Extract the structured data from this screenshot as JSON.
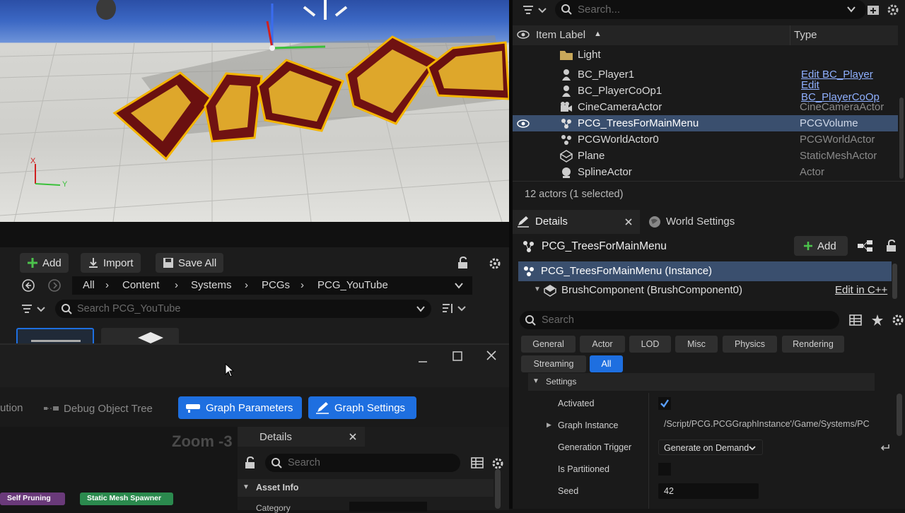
{
  "viewport": {
    "axis_x_label": "X",
    "axis_y_label": "Y"
  },
  "outliner": {
    "search_placeholder": "Search...",
    "col_label": "Item Label",
    "col_type": "Type",
    "rows": [
      {
        "label": "Light",
        "type": ""
      },
      {
        "label": "BC_Player1",
        "type": "Edit BC_Player"
      },
      {
        "label": "BC_PlayerCoOp1",
        "type": "Edit BC_PlayerCoOp"
      },
      {
        "label": "CineCameraActor",
        "type": "CineCameraActor"
      },
      {
        "label": "PCG_TreesForMainMenu",
        "type": "PCGVolume"
      },
      {
        "label": "PCGWorldActor0",
        "type": "PCGWorldActor"
      },
      {
        "label": "Plane",
        "type": "StaticMeshActor"
      },
      {
        "label": "SplineActor",
        "type": "Actor"
      }
    ],
    "status": "12 actors (1 selected)"
  },
  "content_browser": {
    "add": "Add",
    "import": "Import",
    "save_all": "Save All",
    "breadcrumb": [
      "All",
      "Content",
      "Systems",
      "PCGs",
      "PCG_YouTube"
    ],
    "search_placeholder": "Search PCG_YouTube"
  },
  "graph_window": {
    "tab_partial": "ution",
    "debug_tree": "Debug Object Tree",
    "graph_params": "Graph Parameters",
    "graph_settings": "Graph Settings",
    "zoom": "Zoom -3",
    "node_self_pruning": "Self Pruning",
    "node_static_mesh_spawner": "Static Mesh Spawner",
    "details_title": "Details",
    "details_search": "Search",
    "asset_info": "Asset Info",
    "category": "Category"
  },
  "details": {
    "tab_details": "Details",
    "tab_world": "World Settings",
    "actor_name": "PCG_TreesForMainMenu",
    "add": "Add",
    "instance": "PCG_TreesForMainMenu (Instance)",
    "component": "BrushComponent (BrushComponent0)",
    "edit_cpp": "Edit in C++",
    "search_placeholder": "Search",
    "filters": [
      "General",
      "Actor",
      "LOD",
      "Misc",
      "Physics",
      "Rendering",
      "Streaming",
      "All"
    ],
    "section": "Settings",
    "props": {
      "activated": "Activated",
      "graph_instance": "Graph Instance",
      "graph_instance_value": "/Script/PCG.PCGGraphInstance'/Game/Systems/PC",
      "gen_trigger": "Generation Trigger",
      "gen_trigger_value": "Generate on Demand",
      "partitioned": "Is Partitioned",
      "seed": "Seed",
      "seed_value": "42"
    }
  },
  "colors": {
    "accent_blue": "#1e6fe0",
    "selection": "#3a4f6e",
    "link": "#8fb0ff"
  }
}
